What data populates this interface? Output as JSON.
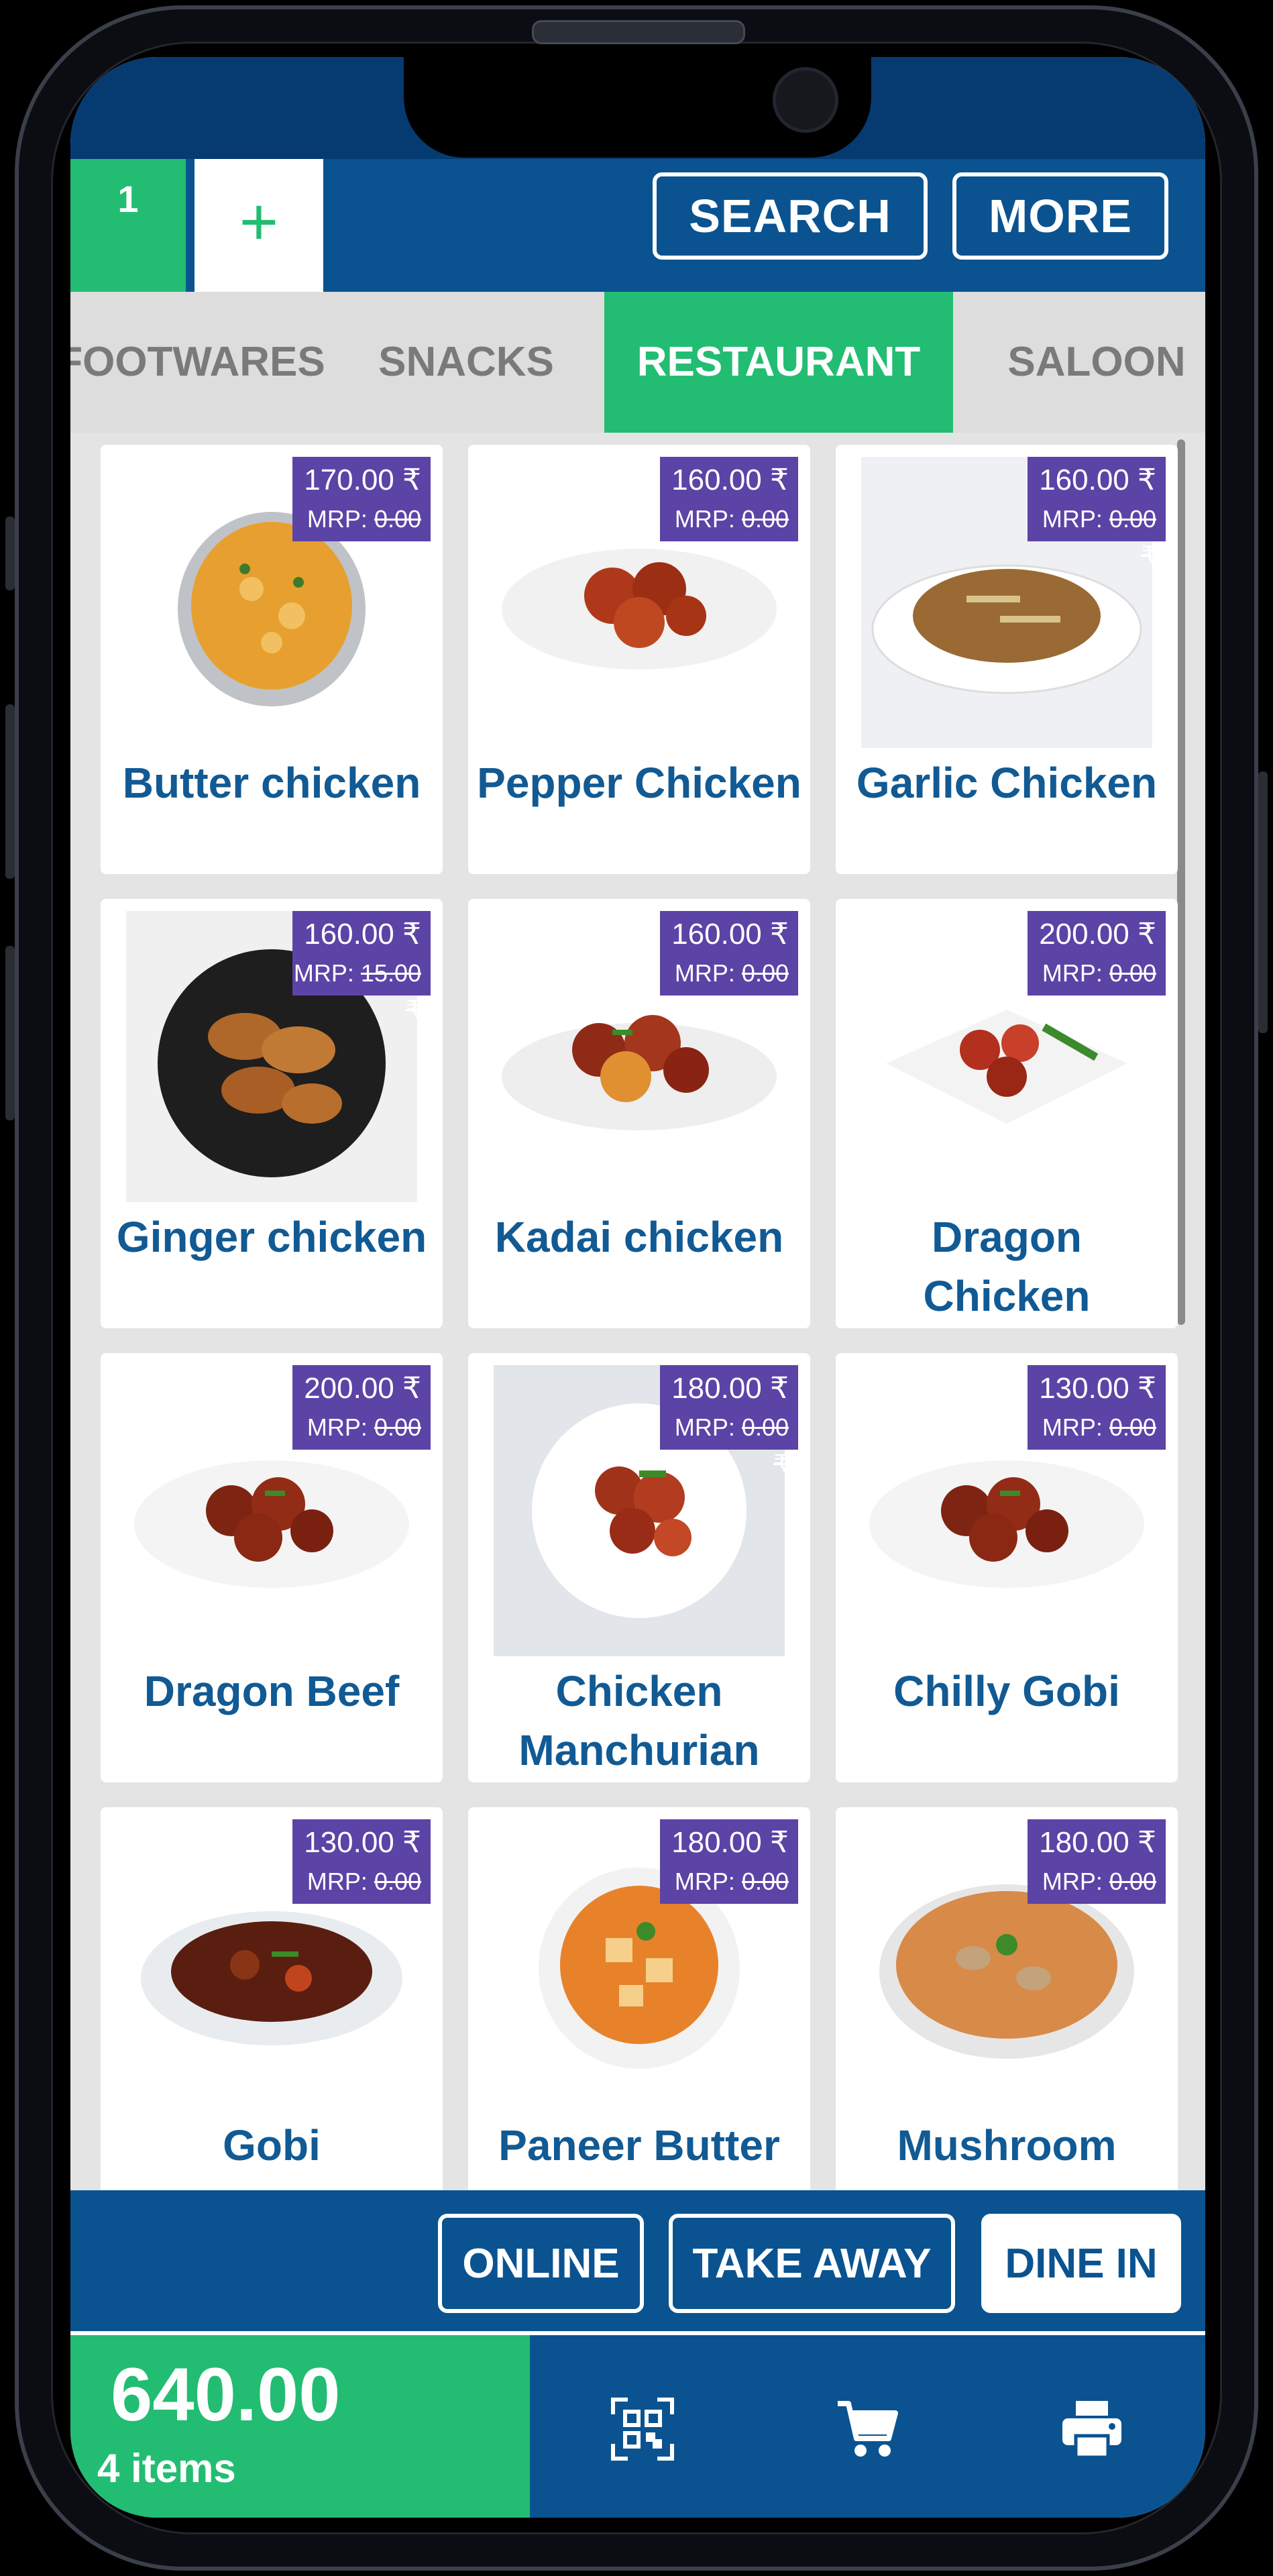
{
  "header": {
    "tab_number": "1",
    "add_tab_symbol": "+",
    "search_label": "SEARCH",
    "more_label": "MORE"
  },
  "categories": [
    {
      "label": "FOOTWARES",
      "active": false
    },
    {
      "label": "SNACKS",
      "active": false
    },
    {
      "label": "RESTAURANT",
      "active": true
    },
    {
      "label": "SALOON",
      "active": false
    }
  ],
  "products": [
    {
      "name": "Butter chicken",
      "price": "170.00 ₹",
      "mrp_label": "MRP:",
      "mrp_value": "0.00 ₹",
      "image": "curry-bowl"
    },
    {
      "name": "Pepper Chicken",
      "price": "160.00 ₹",
      "mrp_label": "MRP:",
      "mrp_value": "0.00 ₹",
      "image": "fried-chicken-plate"
    },
    {
      "name": "Garlic Chicken",
      "price": "160.00 ₹",
      "mrp_label": "MRP:",
      "mrp_value": "0.00 ₹",
      "image": "stir-fry-plate"
    },
    {
      "name": "Ginger chicken",
      "price": "160.00 ₹",
      "mrp_label": "MRP:",
      "mrp_value": "15.00 ₹",
      "image": "chicken-wings-bowl"
    },
    {
      "name": "Kadai chicken",
      "price": "160.00 ₹",
      "mrp_label": "MRP:",
      "mrp_value": "0.00 ₹",
      "image": "chilli-chicken-plate"
    },
    {
      "name": "Dragon Chicken",
      "price": "200.00 ₹",
      "mrp_label": "MRP:",
      "mrp_value": "0.00 ₹",
      "image": "dragon-chicken-plate"
    },
    {
      "name": "Dragon Beef",
      "price": "200.00 ₹",
      "mrp_label": "MRP:",
      "mrp_value": "0.00 ₹",
      "image": "manchurian-plate"
    },
    {
      "name": "Chicken Manchurian",
      "price": "180.00 ₹",
      "mrp_label": "MRP:",
      "mrp_value": "0.00 ₹",
      "image": "manchurian-bowl"
    },
    {
      "name": "Chilly Gobi",
      "price": "130.00 ₹",
      "mrp_label": "MRP:",
      "mrp_value": "0.00 ₹",
      "image": "manchurian-plate"
    },
    {
      "name": "Gobi",
      "price": "130.00 ₹",
      "mrp_label": "MRP:",
      "mrp_value": "0.00 ₹",
      "image": "dark-stir-fry-plate"
    },
    {
      "name": "Paneer Butter",
      "price": "180.00 ₹",
      "mrp_label": "MRP:",
      "mrp_value": "0.00 ₹",
      "image": "paneer-curry-bowl"
    },
    {
      "name": "Mushroom",
      "price": "180.00 ₹",
      "mrp_label": "MRP:",
      "mrp_value": "0.00 ₹",
      "image": "mushroom-curry-bowl"
    }
  ],
  "order_type": {
    "online_label": "ONLINE",
    "takeaway_label": "TAKE AWAY",
    "dinein_label": "DINE IN",
    "selected": "DINE IN"
  },
  "footer": {
    "total_amount": "640.00",
    "items_count": "4 items",
    "icons": [
      "qr-code-icon",
      "cart-icon",
      "printer-icon"
    ]
  },
  "colors": {
    "primary_blue": "#0a5390",
    "accent_green": "#22bd72",
    "price_tag_purple": "#5c43a6",
    "product_name_blue": "#115a94"
  }
}
